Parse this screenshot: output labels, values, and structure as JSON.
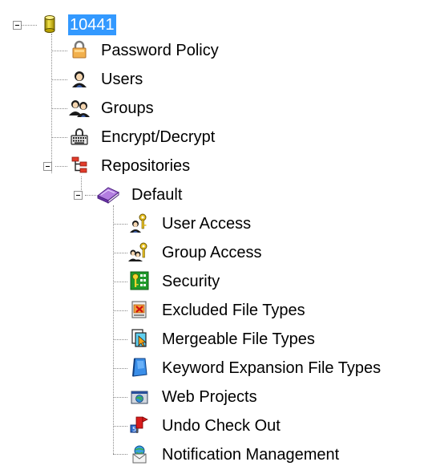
{
  "tree": {
    "root": {
      "label": "10441",
      "icon": "database-icon",
      "expanded": true,
      "selected": true
    },
    "children": [
      {
        "label": "Password Policy",
        "icon": "lock-icon"
      },
      {
        "label": "Users",
        "icon": "user-icon"
      },
      {
        "label": "Groups",
        "icon": "group-icon"
      },
      {
        "label": "Encrypt/Decrypt",
        "icon": "keyboard-lock-icon"
      },
      {
        "label": "Repositories",
        "icon": "repository-tree-icon",
        "expanded": true,
        "children": [
          {
            "label": "Default",
            "icon": "book-icon",
            "expanded": true,
            "children": [
              {
                "label": "User Access",
                "icon": "user-key-icon"
              },
              {
                "label": "Group Access",
                "icon": "group-key-icon"
              },
              {
                "label": "Security",
                "icon": "security-key-icon"
              },
              {
                "label": "Excluded File Types",
                "icon": "excluded-file-icon"
              },
              {
                "label": "Mergeable File Types",
                "icon": "mergeable-file-icon"
              },
              {
                "label": "Keyword Expansion File Types",
                "icon": "keyword-file-icon"
              },
              {
                "label": "Web Projects",
                "icon": "web-project-icon"
              },
              {
                "label": "Undo Check Out",
                "icon": "undo-checkout-icon"
              },
              {
                "label": "Notification Management",
                "icon": "notification-mail-icon"
              }
            ]
          }
        ]
      }
    ]
  },
  "colors": {
    "selection": "#3399ff",
    "connector": "#8a8a8a"
  }
}
